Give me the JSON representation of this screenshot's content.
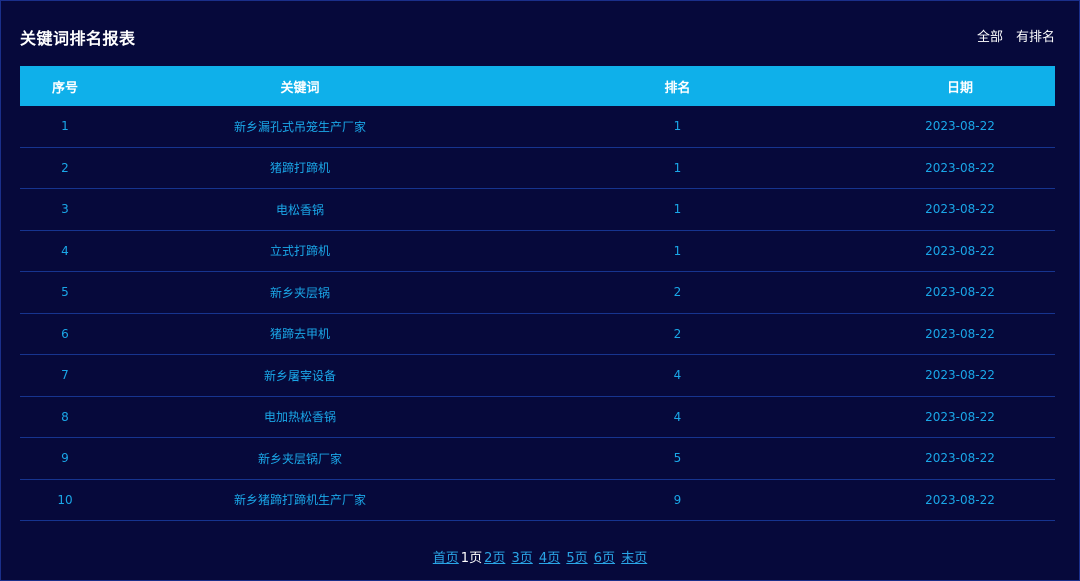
{
  "page": {
    "title": "关键词排名报表",
    "filters": [
      "全部",
      "有排名"
    ]
  },
  "table": {
    "headers": [
      "序号",
      "关键词",
      "排名",
      "日期"
    ],
    "rows": [
      [
        "1",
        "新乡漏孔式吊笼生产厂家",
        "1",
        "2023-08-22"
      ],
      [
        "2",
        "猪蹄打蹄机",
        "1",
        "2023-08-22"
      ],
      [
        "3",
        "电松香锅",
        "1",
        "2023-08-22"
      ],
      [
        "4",
        "立式打蹄机",
        "1",
        "2023-08-22"
      ],
      [
        "5",
        "新乡夹层锅",
        "2",
        "2023-08-22"
      ],
      [
        "6",
        "猪蹄去甲机",
        "2",
        "2023-08-22"
      ],
      [
        "7",
        "新乡屠宰设备",
        "4",
        "2023-08-22"
      ],
      [
        "8",
        "电加热松香锅",
        "4",
        "2023-08-22"
      ],
      [
        "9",
        "新乡夹层锅厂家",
        "5",
        "2023-08-22"
      ],
      [
        "10",
        "新乡猪蹄打蹄机生产厂家",
        "9",
        "2023-08-22"
      ]
    ]
  },
  "pagination": {
    "first": "首页",
    "current": "1页",
    "pages": [
      "2页",
      "3页",
      "4页",
      "5页",
      "6页"
    ],
    "last": "末页"
  },
  "colors": {
    "background": "#06093b",
    "header_bg": "#0fb0ea",
    "cell_text": "#1aa7e8",
    "row_divider": "#16348f"
  }
}
